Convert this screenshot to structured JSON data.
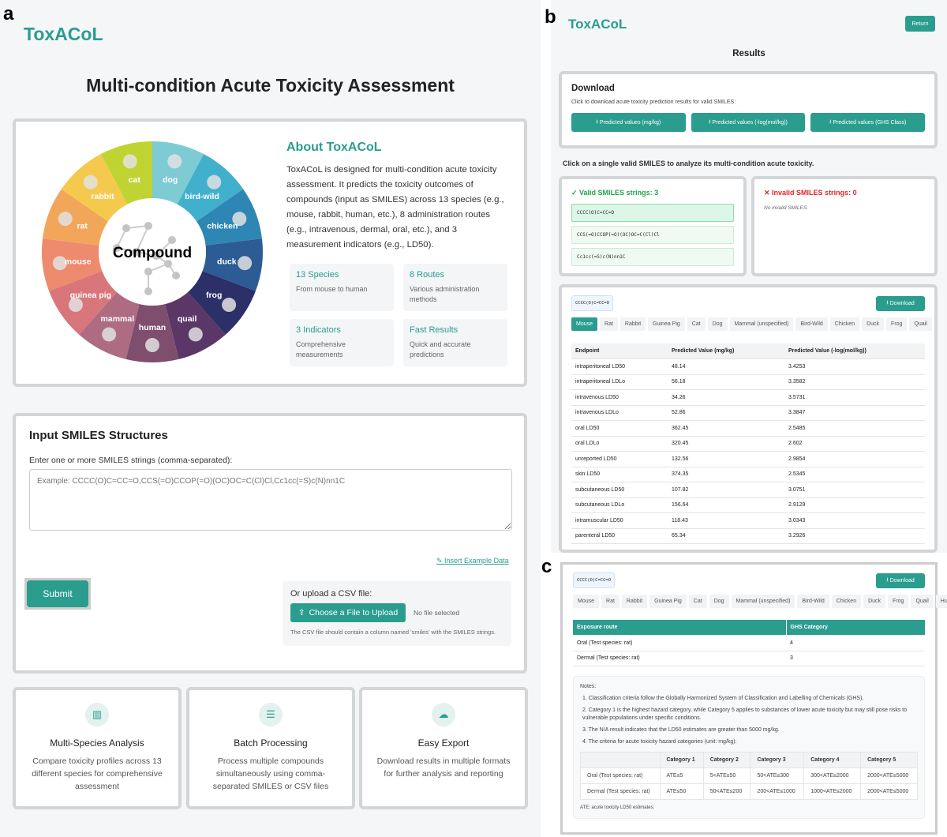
{
  "panel_labels": {
    "a": "a",
    "b": "b",
    "c": "c"
  },
  "brand": "ToxACoL",
  "main_title": "Multi-condition Acute Toxicity Assessment",
  "wheel": {
    "center": "Compound",
    "segments": [
      {
        "label": "dog",
        "color": "#7ecbd3"
      },
      {
        "label": "bird-wild",
        "color": "#41b0cc"
      },
      {
        "label": "chicken",
        "color": "#2e86b4"
      },
      {
        "label": "duck",
        "color": "#2d5b93"
      },
      {
        "label": "frog",
        "color": "#2c2f68"
      },
      {
        "label": "quail",
        "color": "#5a3766"
      },
      {
        "label": "human",
        "color": "#7f4d6e"
      },
      {
        "label": "mammal",
        "color": "#ad6c82"
      },
      {
        "label": "guinea pig",
        "color": "#d9767b"
      },
      {
        "label": "mouse",
        "color": "#ee8a6d"
      },
      {
        "label": "rat",
        "color": "#f2a65a"
      },
      {
        "label": "rabbit",
        "color": "#f5c94e"
      },
      {
        "label": "cat",
        "color": "#bfd433"
      }
    ]
  },
  "about": {
    "title": "About ToxACoL",
    "text": "ToxACoL is designed for multi-condition acute toxicity assessment. It predicts the toxicity outcomes of compounds (input as SMILES) across 13 species (e.g., mouse, rabbit, human, etc.), 8 administration routes (e.g., intravenous, dermal, oral, etc.), and 3 measurement indicators (e.g., LD50).",
    "stats": [
      {
        "title": "13 Species",
        "desc": "From mouse to human"
      },
      {
        "title": "8 Routes",
        "desc": "Various administration methods"
      },
      {
        "title": "3 Indicators",
        "desc": "Comprehensive measurements"
      },
      {
        "title": "Fast Results",
        "desc": "Quick and accurate predictions"
      }
    ]
  },
  "input": {
    "title": "Input SMILES Structures",
    "label": "Enter one or more SMILES strings (comma-separated):",
    "placeholder": "Example: CCCC(O)C=CC=O,CCS(=O)CCOP(=O)(OC)OC=C(Cl)Cl,Cc1cc(=S)c(N)nn1C",
    "example_link": "Insert Example Data",
    "submit": "Submit",
    "upload_label": "Or upload a CSV file:",
    "upload_button": "Choose a File to Upload",
    "no_file": "No file selected",
    "csv_hint": "The CSV file should contain a column named 'smiles' with the SMILES strings."
  },
  "features": [
    {
      "icon": "bar-chart-icon",
      "title": "Multi-Species Analysis",
      "desc": "Compare toxicity profiles across 13 different species for comprehensive assessment"
    },
    {
      "icon": "database-icon",
      "title": "Batch Processing",
      "desc": "Process multiple compounds simultaneously using comma-separated SMILES or CSV files"
    },
    {
      "icon": "cloud-download-icon",
      "title": "Easy Export",
      "desc": "Download results in multiple formats for further analysis and reporting"
    }
  ],
  "results": {
    "return": "Return",
    "title": "Results",
    "download_title": "Download",
    "download_desc": "Click to download acute toxicity prediction results for valid SMILES:",
    "download_buttons": [
      "Predicted values (mg/kg)",
      "Predicted values (-log(mol/kg))",
      "Predicted values (GHS Class)"
    ],
    "instruction": "Click on a single valid SMILES to analyze its multi-condition acute toxicity.",
    "valid_title": "Valid SMILES strings: 3",
    "valid": [
      "CCCC(O)C=CC=O",
      "CCS(=O)CCOP(=O)(OC)OC=C(Cl)Cl",
      "Cc1cc(=S)c(N)nn1C"
    ],
    "invalid_title": "Invalid SMILES strings: 0",
    "invalid_empty": "No invalid SMILES."
  },
  "detail": {
    "smiles": "CCCC(O)C=CC=O",
    "download": "Download",
    "tabs": [
      "Mouse",
      "Rat",
      "Rabbit",
      "Guinea Pig",
      "Cat",
      "Dog",
      "Mammal (unspecified)",
      "Bird-Wild",
      "Chicken",
      "Duck",
      "Frog",
      "Quail",
      "Huma"
    ],
    "headers": [
      "Endpoint",
      "Predicted Value (mg/kg)",
      "Predicted Value (-log(mol/kg))"
    ],
    "rows": [
      [
        "intraperitoneal LD50",
        "48.14",
        "3.4253"
      ],
      [
        "intraperitoneal LDLo",
        "56.18",
        "3.3582"
      ],
      [
        "intravenous LD50",
        "34.26",
        "3.5731"
      ],
      [
        "intravenous LDLo",
        "52.86",
        "3.3847"
      ],
      [
        "oral LD50",
        "362.45",
        "2.5485"
      ],
      [
        "oral LDLo",
        "320.45",
        "2.602"
      ],
      [
        "unreported LD50",
        "132.56",
        "2.9854"
      ],
      [
        "skin LD50",
        "374.35",
        "2.5345"
      ],
      [
        "subcutaneous LD50",
        "107.82",
        "3.0751"
      ],
      [
        "subcutaneous LDLo",
        "156.64",
        "2.9129"
      ],
      [
        "intramuscular LD50",
        "118.43",
        "3.0343"
      ],
      [
        "parenteral LD50",
        "65.34",
        "3.2926"
      ]
    ]
  },
  "ghs": {
    "headers": [
      "Exposure route",
      "GHS Category"
    ],
    "rows": [
      [
        "Oral (Test species: rat)",
        "4"
      ],
      [
        "Dermal (Test species: rat)",
        "3"
      ]
    ],
    "notes_title": "Notes:",
    "notes": [
      "1. Classification criteria follow the Globally Harmonized System of Classification and Labelling of Chemicals (GHS).",
      "2. Category 1 is the highest hazard category, while Category 5 applies to substances of lower acute toxicity but may still pose risks to vulnerable populations under specific conditions.",
      "3. The N/A result indicates that the LD50 estimates are greater than 5000 mg/kg.",
      "4. The criteria for acute toxicity hazard categories (unit: mg/kg):"
    ],
    "criteria_headers": [
      "",
      "Category 1",
      "Category 2",
      "Category 3",
      "Category 4",
      "Category 5"
    ],
    "criteria_rows": [
      [
        "Oral (Test species: rat)",
        "ATE≤5",
        "5<ATE≤50",
        "50<ATE≤300",
        "300<ATE≤2000",
        "2000<ATE≤5000"
      ],
      [
        "Dermal (Test species: rat)",
        "ATE≤50",
        "50<ATE≤200",
        "200<ATE≤1000",
        "1000<ATE≤2000",
        "2000<ATE≤5000"
      ]
    ],
    "footnote": "ATE: acute toxicity LD50 estimates."
  },
  "colors": {
    "accent": "#2a9d8f",
    "valid": "#22a34a",
    "invalid": "#dc2626"
  }
}
